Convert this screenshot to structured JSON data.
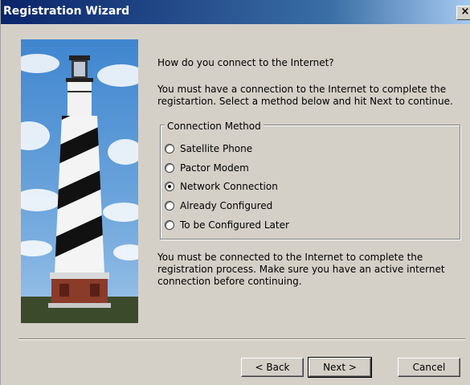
{
  "window": {
    "title": "Registration Wizard",
    "close_glyph": "×"
  },
  "banner": {
    "image": "lighthouse-photo",
    "sky_color": "#4a8ed0",
    "stripe_color": "#111111"
  },
  "content": {
    "prompt": "How do you connect to the Internet?",
    "instructions": "You must have a connection to the Internet to complete the registartion. Select a method below and hit Next to continue.",
    "group_title": "Connection Method",
    "options": [
      {
        "label": "Satellite Phone",
        "selected": false
      },
      {
        "label": "Pactor Modem",
        "selected": false
      },
      {
        "label": "Network Connection",
        "selected": true
      },
      {
        "label": "Already Configured",
        "selected": false
      },
      {
        "label": "To be Configured Later",
        "selected": false
      }
    ],
    "footnote": "You must be connected to the Internet to complete the registration process.  Make sure you have an active internet connection before continuing."
  },
  "buttons": {
    "back": "< Back",
    "next": "Next >",
    "cancel": "Cancel"
  }
}
